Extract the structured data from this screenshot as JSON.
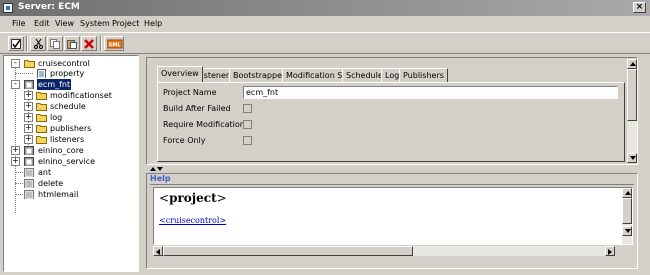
{
  "window": {
    "title": "Server: ECM"
  },
  "menu": [
    "File",
    "Edit",
    "View",
    "System",
    "Project",
    "Help"
  ],
  "toolbar": {
    "buttons": [
      {
        "name": "save-button",
        "icon": "save-check-icon"
      },
      {
        "name": "cut-button",
        "icon": "scissors-icon"
      },
      {
        "name": "copy-button",
        "icon": "copy-icon"
      },
      {
        "name": "paste-button",
        "icon": "paste-icon"
      },
      {
        "name": "delete-button",
        "icon": "red-x-icon"
      },
      {
        "name": "xml-button",
        "icon": "xml-icon",
        "label": "XML"
      }
    ]
  },
  "tree": {
    "nodes": [
      {
        "label": "cruisecontrol",
        "icon": "folder-icon",
        "expander": "-"
      },
      {
        "label": "property",
        "icon": "document-icon"
      },
      {
        "label": "ecm_fnt",
        "icon": "project-icon",
        "expander": "-",
        "selected": true
      },
      {
        "label": "modificationset",
        "icon": "folder-icon",
        "expander": "+"
      },
      {
        "label": "schedule",
        "icon": "folder-icon",
        "expander": "+"
      },
      {
        "label": "log",
        "icon": "folder-icon",
        "expander": "+"
      },
      {
        "label": "publishers",
        "icon": "folder-icon",
        "expander": "+"
      },
      {
        "label": "listeners",
        "icon": "folder-icon",
        "expander": "+"
      },
      {
        "label": "elnino_core",
        "icon": "project-icon",
        "expander": "+"
      },
      {
        "label": "elnino_service",
        "icon": "project-icon",
        "expander": "+"
      },
      {
        "label": "ant",
        "icon": "plugin-icon"
      },
      {
        "label": "delete",
        "icon": "plugin-icon"
      },
      {
        "label": "htmlemail",
        "icon": "plugin-icon"
      }
    ]
  },
  "tabs": [
    "Overview",
    "Listeners",
    "Bootstrappers",
    "Modification Sets",
    "Schedule",
    "Log",
    "Publishers"
  ],
  "active_tab": "Overview",
  "form": {
    "project_name_label": "Project Name",
    "project_name_value": "ecm_fnt",
    "build_after_failed_label": "Build After Failed",
    "require_modification_label": "Require Modification",
    "force_only_label": "Force Only"
  },
  "help": {
    "title": "Help",
    "tag_open": "<",
    "tag_name": "project",
    "tag_close": ">",
    "link": "<cruisecontrol>"
  }
}
